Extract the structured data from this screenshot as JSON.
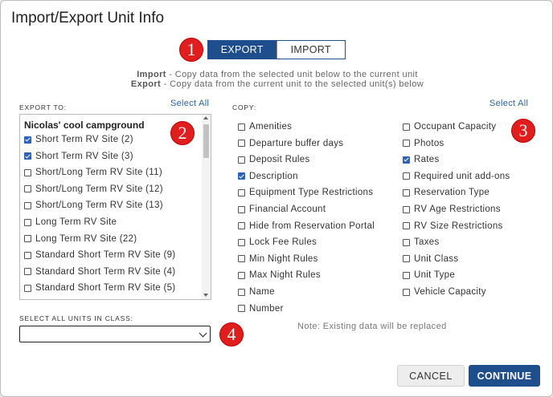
{
  "dialog": {
    "title": "Import/Export Unit Info"
  },
  "mode_toggle": {
    "export_label": "EXPORT",
    "import_label": "IMPORT",
    "selected": "EXPORT"
  },
  "badges": [
    "1",
    "2",
    "3",
    "4"
  ],
  "description": {
    "import_term": "Import",
    "import_text": " - Copy data from the selected unit below to the current unit",
    "export_term": "Export",
    "export_text": " - Copy data from the current unit to the selected unit(s) below"
  },
  "export_to": {
    "label": "EXPORT TO:",
    "select_all": "Select All",
    "group_name": "Nicolas' cool campground",
    "units": [
      {
        "label": "Short Term RV Site (2)",
        "checked": true
      },
      {
        "label": "Short Term RV Site (3)",
        "checked": true
      },
      {
        "label": "Short/Long Term RV Site (11)",
        "checked": false
      },
      {
        "label": "Short/Long Term RV Site (12)",
        "checked": false
      },
      {
        "label": "Short/Long Term RV Site (13)",
        "checked": false
      },
      {
        "label": "Long Term RV Site",
        "checked": false
      },
      {
        "label": "Long Term RV Site (22)",
        "checked": false
      },
      {
        "label": "Standard Short Term RV Site (9)",
        "checked": false
      },
      {
        "label": "Standard Short Term RV Site (4)",
        "checked": false
      },
      {
        "label": "Standard Short Term RV Site (5)",
        "checked": false
      }
    ]
  },
  "copy": {
    "label": "COPY:",
    "select_all": "Select All",
    "left_items": [
      {
        "label": "Amenities",
        "checked": false
      },
      {
        "label": "Departure buffer days",
        "checked": false
      },
      {
        "label": "Deposit Rules",
        "checked": false
      },
      {
        "label": "Description",
        "checked": true
      },
      {
        "label": "Equipment Type Restrictions",
        "checked": false
      },
      {
        "label": "Financial Account",
        "checked": false
      },
      {
        "label": "Hide from Reservation Portal",
        "checked": false
      },
      {
        "label": "Lock Fee Rules",
        "checked": false
      },
      {
        "label": "Min Night Rules",
        "checked": false
      },
      {
        "label": "Max Night Rules",
        "checked": false
      },
      {
        "label": "Name",
        "checked": false
      },
      {
        "label": "Number",
        "checked": false
      }
    ],
    "right_items": [
      {
        "label": "Occupant Capacity",
        "checked": false
      },
      {
        "label": "Photos",
        "checked": false
      },
      {
        "label": "Rates",
        "checked": true
      },
      {
        "label": "Required unit add-ons",
        "checked": false
      },
      {
        "label": "Reservation Type",
        "checked": false
      },
      {
        "label": "RV Age Restrictions",
        "checked": false
      },
      {
        "label": "RV Size Restrictions",
        "checked": false
      },
      {
        "label": "Taxes",
        "checked": false
      },
      {
        "label": "Unit Class",
        "checked": false
      },
      {
        "label": "Unit Type",
        "checked": false
      },
      {
        "label": "Vehicle Capacity",
        "checked": false
      }
    ]
  },
  "class_select": {
    "label": "SELECT ALL UNITS IN CLASS:",
    "value": ""
  },
  "note": "Note: Existing data will be replaced",
  "buttons": {
    "cancel": "CANCEL",
    "continue": "CONTINUE"
  },
  "colors": {
    "primary": "#1f4e8c",
    "link": "#2b63a6",
    "checkbox": "#2c62b8",
    "badge": "#e01e1e"
  }
}
